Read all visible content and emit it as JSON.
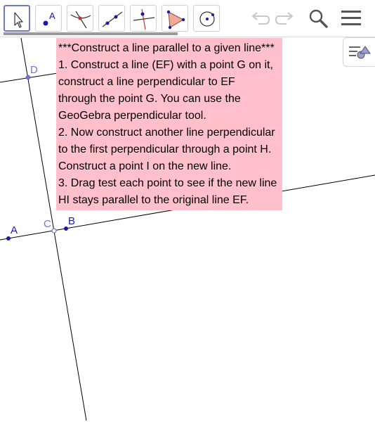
{
  "toolbar": {
    "tools": [
      {
        "name": "move-tool",
        "selected": true
      },
      {
        "name": "point-tool",
        "label": "A"
      },
      {
        "name": "intersect-tool"
      },
      {
        "name": "line-tool"
      },
      {
        "name": "perpendicular-line-tool"
      },
      {
        "name": "polygon-tool"
      },
      {
        "name": "circle-tool"
      }
    ],
    "right_icons": [
      "undo-icon",
      "redo-icon",
      "search-icon",
      "menu-icon"
    ]
  },
  "instructions": {
    "lines": [
      "***Construct a line parallel to a given line***",
      "1. Construct a line (EF) with a point G on it,",
      "construct a line perpendicular to EF",
      "through the point G. You can use the",
      "GeoGebra perpendicular tool.",
      "2. Now construct another line perpendicular",
      "to the first perpendicular through a point H.",
      "Construct a point I on the new line.",
      "3. Drag test each point to see if the new line",
      "HI stays parallel to the original line EF."
    ],
    "background": "#ffc0cb"
  },
  "points": {
    "A": "A",
    "B": "B",
    "C": "C",
    "D": "D"
  },
  "colors": {
    "point_free": "#1a1aa6",
    "point_dependent": "#6e78d2",
    "selected_tool": "#6e7bc4"
  }
}
